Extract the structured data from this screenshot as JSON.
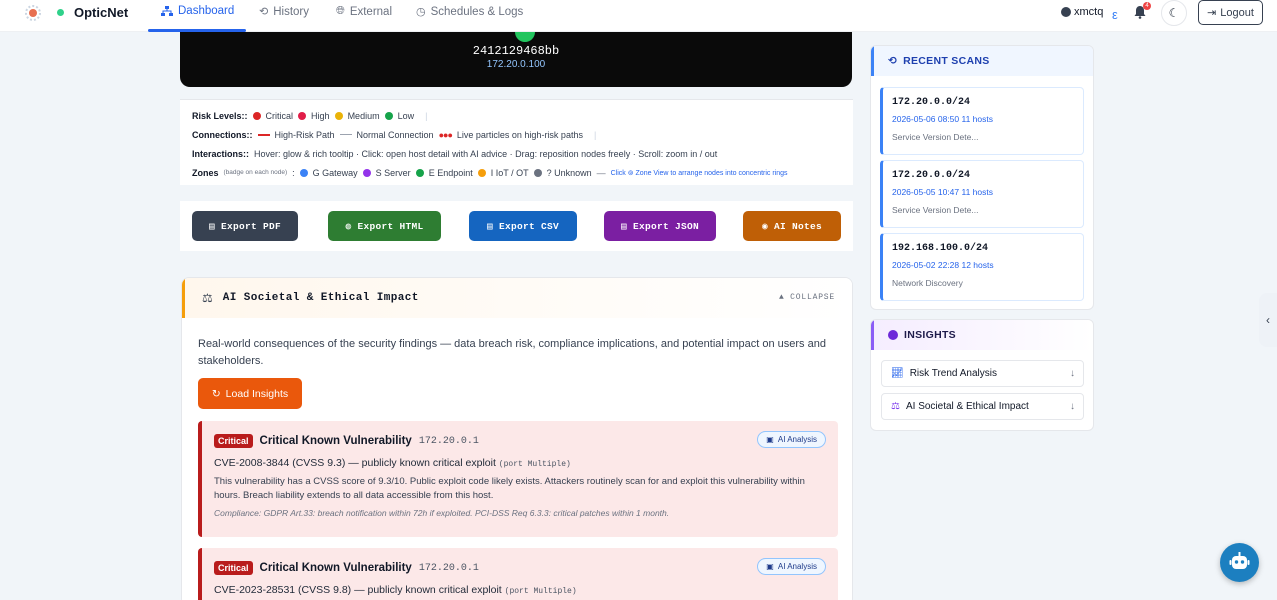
{
  "nav": {
    "brand": "OpticNet",
    "links": [
      {
        "label": "Dashboard",
        "icon": "sitemap-icon"
      },
      {
        "label": "History",
        "icon": "history-icon"
      },
      {
        "label": "External",
        "icon": "globe-icon"
      },
      {
        "label": "Schedules & Logs",
        "icon": "clock-icon"
      }
    ],
    "username": "xmctq",
    "notif_count": "4",
    "logout_label": "Logout"
  },
  "topology": {
    "hostname": "2412129468bb",
    "ip": "172.20.0.100"
  },
  "legend": {
    "risk_label": "Risk Levels::",
    "risk": [
      {
        "label": "Critical",
        "color": "#dc2626"
      },
      {
        "label": "High",
        "color": "#e11d48"
      },
      {
        "label": "Medium",
        "color": "#eab308"
      },
      {
        "label": "Low",
        "color": "#16a34a"
      }
    ],
    "connections_label": "Connections::",
    "high_risk": "High-Risk Path",
    "normal": "Normal Connection",
    "particles": "Live particles on high-risk paths",
    "interactions_label": "Interactions::",
    "interactions": "Hover: glow & rich tooltip · Click: open host detail with AI advice · Drag: reposition nodes freely · Scroll: zoom in / out",
    "zones_label": "Zones",
    "zones_note": "(badge on each node)",
    "zones": [
      {
        "label": "G Gateway",
        "color": "#3b82f6"
      },
      {
        "label": "S Server",
        "color": "#9333ea"
      },
      {
        "label": "E Endpoint",
        "color": "#16a34a"
      },
      {
        "label": "I IoT / OT",
        "color": "#f59e0b"
      },
      {
        "label": "? Unknown",
        "color": "#6b7280"
      }
    ],
    "zone_tip": "Click ⊚ Zone View to arrange nodes into concentric rings"
  },
  "exports": [
    {
      "label": "Export PDF",
      "color": "#374151"
    },
    {
      "label": "Export HTML",
      "color": "#2e7d32"
    },
    {
      "label": "Export CSV",
      "color": "#1565c0"
    },
    {
      "label": "Export JSON",
      "color": "#7b1fa2"
    },
    {
      "label": "AI Notes",
      "color": "#bf5f06"
    }
  ],
  "impact": {
    "title": "AI Societal & Ethical Impact",
    "collapse": "▲ COLLAPSE",
    "description": "Real-world consequences of the security findings — data breach risk, compliance implications, and potential impact on users and stakeholders.",
    "load_label": "Load Insights",
    "findings": [
      {
        "severity": "Critical",
        "title": "Critical Known Vulnerability",
        "ip": "172.20.0.1",
        "ai": "AI Analysis",
        "cve": "CVE-2008-3844 (CVSS 9.3) — publicly known critical exploit",
        "port": "(port Multiple)",
        "body": "This vulnerability has a CVSS score of 9.3/10. Public exploit code likely exists. Attackers routinely scan for and exploit this vulnerability within hours. Breach liability extends to all data accessible from this host.",
        "compliance": "Compliance: GDPR Art.33: breach notification within 72h if exploited. PCI-DSS Req 6.3.3: critical patches within 1 month."
      },
      {
        "severity": "Critical",
        "title": "Critical Known Vulnerability",
        "ip": "172.20.0.1",
        "ai": "AI Analysis",
        "cve": "CVE-2023-28531 (CVSS 9.8) — publicly known critical exploit",
        "port": "(port Multiple)"
      }
    ]
  },
  "recent_scans": {
    "title": "RECENT SCANS",
    "items": [
      {
        "network": "172.20.0.0/24",
        "meta": "2026-05-06 08:50  11 hosts",
        "type": "Service Version Dete..."
      },
      {
        "network": "172.20.0.0/24",
        "meta": "2026-05-05 10:47  11 hosts",
        "type": "Service Version Dete..."
      },
      {
        "network": "192.168.100.0/24",
        "meta": "2026-05-02 22:28  12 hosts",
        "type": "Network Discovery"
      }
    ]
  },
  "insights": {
    "title": "INSIGHTS",
    "items": [
      {
        "label": "Risk Trend Analysis",
        "icon": "chart-line-icon"
      },
      {
        "label": "AI Societal & Ethical Impact",
        "icon": "scale-icon"
      }
    ]
  }
}
